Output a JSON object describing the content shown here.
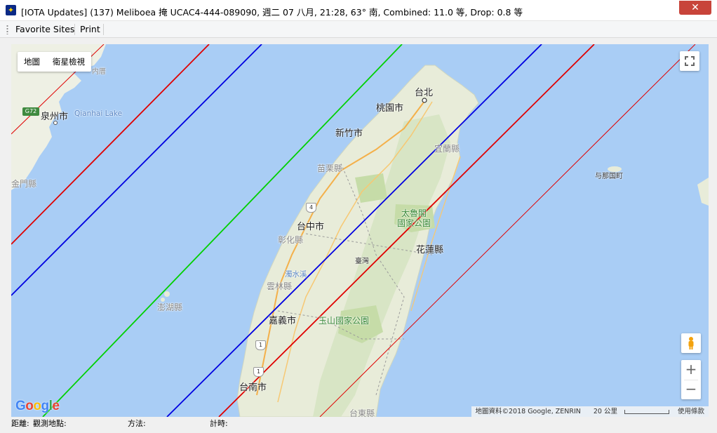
{
  "window": {
    "title": "[IOTA Updates] (137) Meliboea 掩 UCAC4-444-089090, 週二 07 八月, 21:28, 63° 南, Combined: 11.0 等, Drop:  0.8 等",
    "close_label": "✕",
    "icon": "app-star-icon"
  },
  "menu": {
    "items": [
      {
        "label": "Favorite Sites"
      },
      {
        "label": "Print"
      }
    ]
  },
  "map": {
    "map_types": [
      {
        "label": "地圖"
      },
      {
        "label": "衛星檢視"
      }
    ],
    "zoom_in_label": "+",
    "zoom_out_label": "−",
    "google_logo": "Google",
    "attribution": {
      "data": "地圖資料©2018 Google, ZENRIN",
      "scale": "20 公里",
      "terms": "使用條款"
    },
    "places": {
      "taipei": "台北",
      "taoyuan": "桃園市",
      "hsinchu": "新竹市",
      "yilan": "宜蘭縣",
      "miaoli": "苗栗縣",
      "taichung": "台中市",
      "changhua": "彰化縣",
      "taroko": "太魯閣\n國家公園",
      "hualien": "花蓮縣",
      "taiwan": "臺灣",
      "yunlin": "雲林縣",
      "penghu": "澎湖縣",
      "chiayi": "嘉義市",
      "yushan": "玉山國家公園",
      "tainan": "台南市",
      "taitung": "台東縣",
      "quanzhou": "泉州市",
      "qianhai_lake": "Qianhai Lake",
      "yonaguni": "与那国町",
      "jinmen": "金門縣",
      "zhuoshui": "濁水溪",
      "neitu": "内厝",
      "g72": "G72",
      "hwy4": "4",
      "hwy1a": "1",
      "hwy1b": "1"
    },
    "colors": {
      "center_line": "#00d000",
      "path_limit": "#0000e0",
      "sigma_limit": "#e00000",
      "water": "#a9cdf5",
      "land": "#e8ecd9"
    }
  },
  "status": {
    "distance": "距離:",
    "observer": "觀測地點:",
    "method": "方法:",
    "timing": "計時:"
  }
}
